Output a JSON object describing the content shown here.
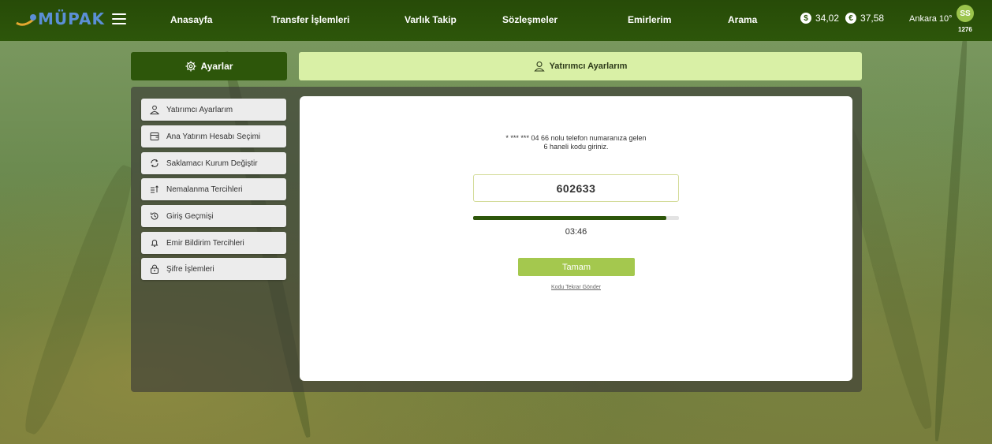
{
  "brand": {
    "name": "MÜPAK"
  },
  "nav": {
    "items": [
      "Anasayfa",
      "Transfer İşlemleri",
      "Varlık Takip",
      "Sözleşmeler",
      "Emirlerim",
      "Arama"
    ]
  },
  "rates": {
    "usd": {
      "icon": "dollar-icon",
      "value": "34,02"
    },
    "eur": {
      "icon": "euro-icon",
      "value": "37,58"
    }
  },
  "weather": {
    "text": "Ankara 10°"
  },
  "user": {
    "initials": "SS",
    "number": "1276"
  },
  "settings_tab": {
    "label": "Ayarlar",
    "icon": "gear-icon"
  },
  "section": {
    "title": "Yatırımcı Ayarlarım",
    "icon": "user-icon"
  },
  "sidebar": {
    "items": [
      {
        "label": "Yatırımcı Ayarlarım",
        "icon": "user-icon"
      },
      {
        "label": "Ana Yatırım Hesabı Seçimi",
        "icon": "wallet-icon"
      },
      {
        "label": "Saklamacı Kurum Değiştir",
        "icon": "refresh-icon"
      },
      {
        "label": "Nemalanma Tercihleri",
        "icon": "sort-icon"
      },
      {
        "label": "Giriş Geçmişi",
        "icon": "history-icon"
      },
      {
        "label": "Emir Bildirim Tercihleri",
        "icon": "bell-icon"
      },
      {
        "label": "Şifre İşlemleri",
        "icon": "lock-icon"
      }
    ]
  },
  "verification": {
    "message_line1": "* *** *** 04 66 nolu telefon numaranıza gelen",
    "message_line2": "6 haneli kodu giriniz.",
    "code": "602633",
    "progress": 0.94,
    "timer": "03:46",
    "submit_label": "Tamam",
    "resend_label": "Kodu Tekrar Gönder"
  },
  "colors": {
    "nav_bg": "#2d560a",
    "accent": "#a4c84e",
    "header_bg": "#d9f0a6",
    "brand_blue": "#5b8fd6"
  }
}
